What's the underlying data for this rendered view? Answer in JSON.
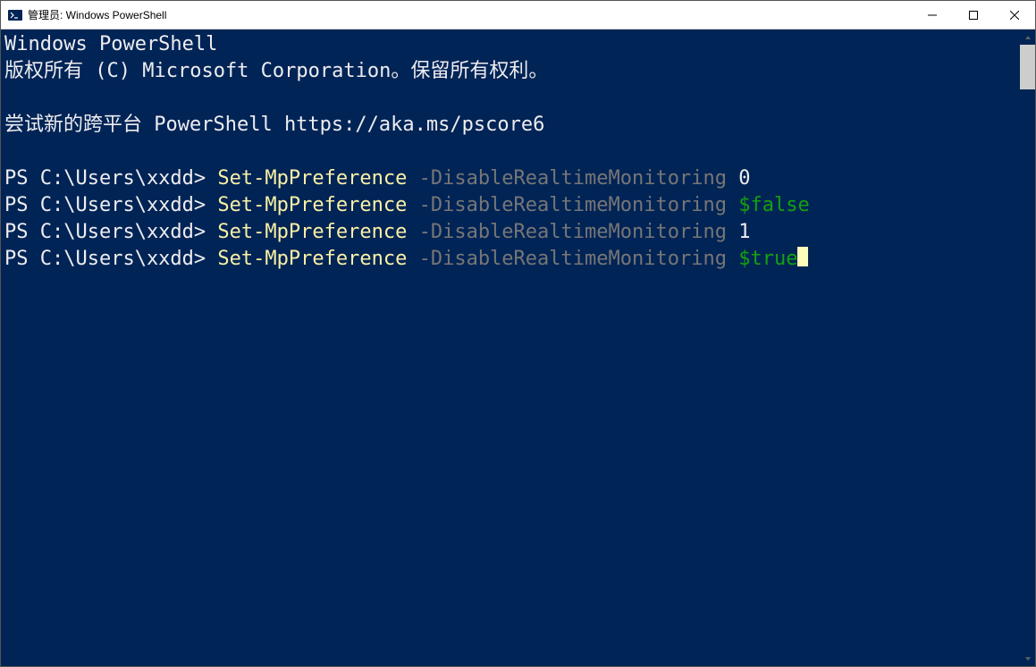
{
  "titlebar": {
    "title": "管理员: Windows PowerShell"
  },
  "terminal": {
    "header_line1": "Windows PowerShell",
    "header_line2": "版权所有 (C) Microsoft Corporation。保留所有权利。",
    "header_line3": "尝试新的跨平台 PowerShell https://aka.ms/pscore6",
    "prompt": "PS C:\\Users\\xxdd> ",
    "commands": [
      {
        "cmdlet": "Set-MpPreference",
        "param": " -DisableRealtimeMonitoring ",
        "value": "0",
        "value_class": "txt-white"
      },
      {
        "cmdlet": "Set-MpPreference",
        "param": " -DisableRealtimeMonitoring ",
        "value": "$false",
        "value_class": "txt-green"
      },
      {
        "cmdlet": "Set-MpPreference",
        "param": " -DisableRealtimeMonitoring ",
        "value": "1",
        "value_class": "txt-white"
      },
      {
        "cmdlet": "Set-MpPreference",
        "param": " -DisableRealtimeMonitoring ",
        "value": "$true",
        "value_class": "txt-green"
      }
    ]
  }
}
